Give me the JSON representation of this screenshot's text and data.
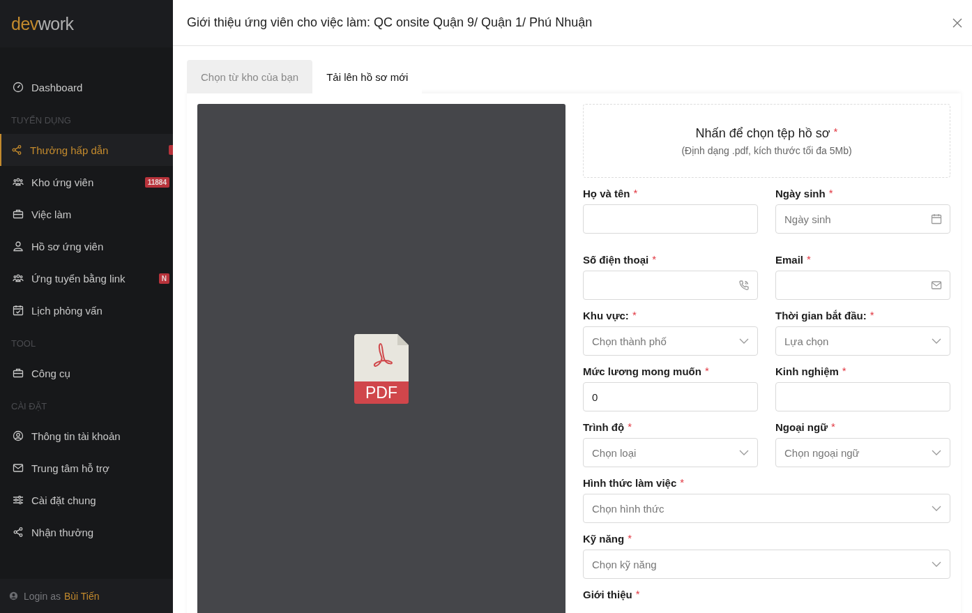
{
  "sidebar": {
    "logo": {
      "part_1": "dev",
      "part_2": "work"
    },
    "sections": [
      {
        "items": [
          {
            "label": "Dashboard",
            "selected": false
          }
        ]
      },
      {
        "title": "TUYỂN DỤNG",
        "items": [
          {
            "label": "Thưởng hấp dẫn",
            "selected": true,
            "badge_sliver": true
          },
          {
            "label": "Kho ứng viên",
            "selected": false,
            "badge": "11884"
          },
          {
            "label": "Việc làm",
            "selected": false
          },
          {
            "label": "Hồ sơ ứng viên",
            "selected": false
          },
          {
            "label": "Ứng tuyển bằng link",
            "selected": false,
            "badge": "N"
          },
          {
            "label": "Lịch phỏng vấn",
            "selected": false
          }
        ]
      },
      {
        "title": "TOOL",
        "items": [
          {
            "label": "Công cụ",
            "selected": false
          }
        ]
      },
      {
        "title": "CÀI ĐẶT",
        "items": [
          {
            "label": "Thông tin tài khoản",
            "selected": false
          },
          {
            "label": "Trung tâm hỗ trợ",
            "selected": false
          },
          {
            "label": "Cài đặt chung",
            "selected": false
          },
          {
            "label": "Nhận thưởng",
            "selected": false
          }
        ]
      }
    ],
    "footer": {
      "prefix": "Login as",
      "user": "Bùi Tiến"
    }
  },
  "modal": {
    "title": "Giới thiệu ứng viên cho việc làm: QC onsite Quận 9/ Quận 1/ Phú Nhuận",
    "tabs": [
      {
        "label": "Chọn từ kho của bạn",
        "selected": false
      },
      {
        "label": "Tải lên hồ sơ mới",
        "selected": true
      }
    ],
    "preview": {
      "label": "PDF"
    },
    "upload": {
      "title": "Nhấn để chọn tệp hồ sơ",
      "required_mark": "*",
      "hint": "(Định dạng .pdf, kích thước tối đa 5Mb)"
    },
    "fields": [
      {
        "label": "Họ và tên",
        "required_mark": "*",
        "kind": "text"
      },
      {
        "label": "Ngày sinh",
        "required_mark": "*",
        "kind": "date",
        "placeholder": "Ngày sinh"
      },
      {
        "label": "Số điện thoại",
        "required_mark": "*",
        "kind": "phone"
      },
      {
        "label": "Email",
        "required_mark": "*",
        "kind": "email"
      },
      {
        "label": "Khu vực:",
        "required_mark": "*",
        "kind": "select",
        "placeholder": "Chọn thành phố"
      },
      {
        "label": "Thời gian bắt đầu:",
        "required_mark": "*",
        "kind": "select",
        "placeholder": "Lựa chọn"
      },
      {
        "label": "Mức lương mong muốn",
        "required_mark": "*",
        "kind": "text",
        "value": "0"
      },
      {
        "label": "Kinh nghiệm",
        "required_mark": "*",
        "kind": "text"
      },
      {
        "label": "Trình độ",
        "required_mark": "*",
        "kind": "select",
        "placeholder": "Chọn loại"
      },
      {
        "label": "Ngoại ngữ",
        "required_mark": "*",
        "kind": "select",
        "placeholder": "Chọn ngoại ngữ"
      },
      {
        "label": "Hình thức làm việc",
        "required_mark": "*",
        "kind": "select",
        "placeholder": "Chọn hình thức",
        "wide": true
      },
      {
        "label": "Kỹ năng",
        "required_mark": "*",
        "kind": "select",
        "placeholder": "Chọn kỹ năng",
        "wide": true
      },
      {
        "label": "Giới thiệu",
        "required_mark": "*",
        "kind": "label_only",
        "wide": true
      }
    ]
  }
}
